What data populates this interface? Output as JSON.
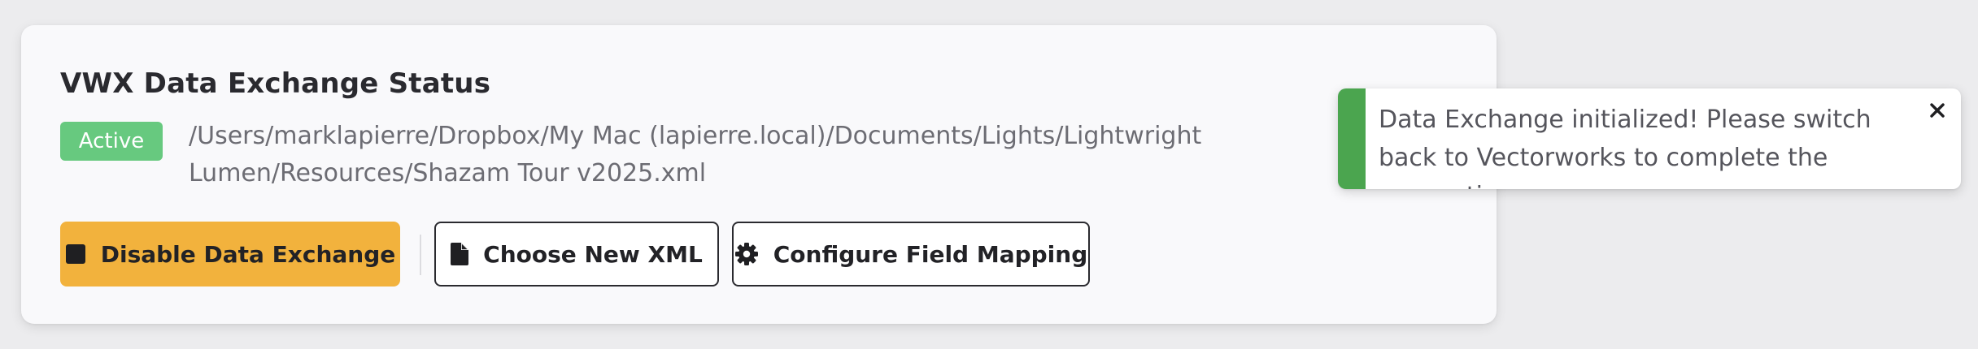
{
  "status_card": {
    "title": "VWX Data Exchange Status",
    "status_badge": "Active",
    "xml_path": "/Users/marklapierre/Dropbox/My Mac (lapierre.local)/Documents/Lights/Lightwright Lumen/Resources/Shazam Tour v2025.xml"
  },
  "actions": {
    "disable_label": "Disable Data Exchange",
    "disable_icon": "stop-square-icon",
    "choose_label": "Choose New XML",
    "choose_icon": "file-icon",
    "configure_label": "Configure Field Mapping",
    "configure_icon": "gear-icon"
  },
  "toast": {
    "message": "Data Exchange initialized! Please switch back to Vectorworks to complete the connection.",
    "close_icon": "close-icon",
    "type": "success"
  },
  "colors": {
    "background": "#ececee",
    "card_background": "#f9f9fb",
    "badge_active": "#67c97f",
    "disable_button": "#f2b23d",
    "toast_accent": "#4ba54f",
    "text_primary": "#2a2a2f",
    "text_secondary": "#6c6c73"
  }
}
